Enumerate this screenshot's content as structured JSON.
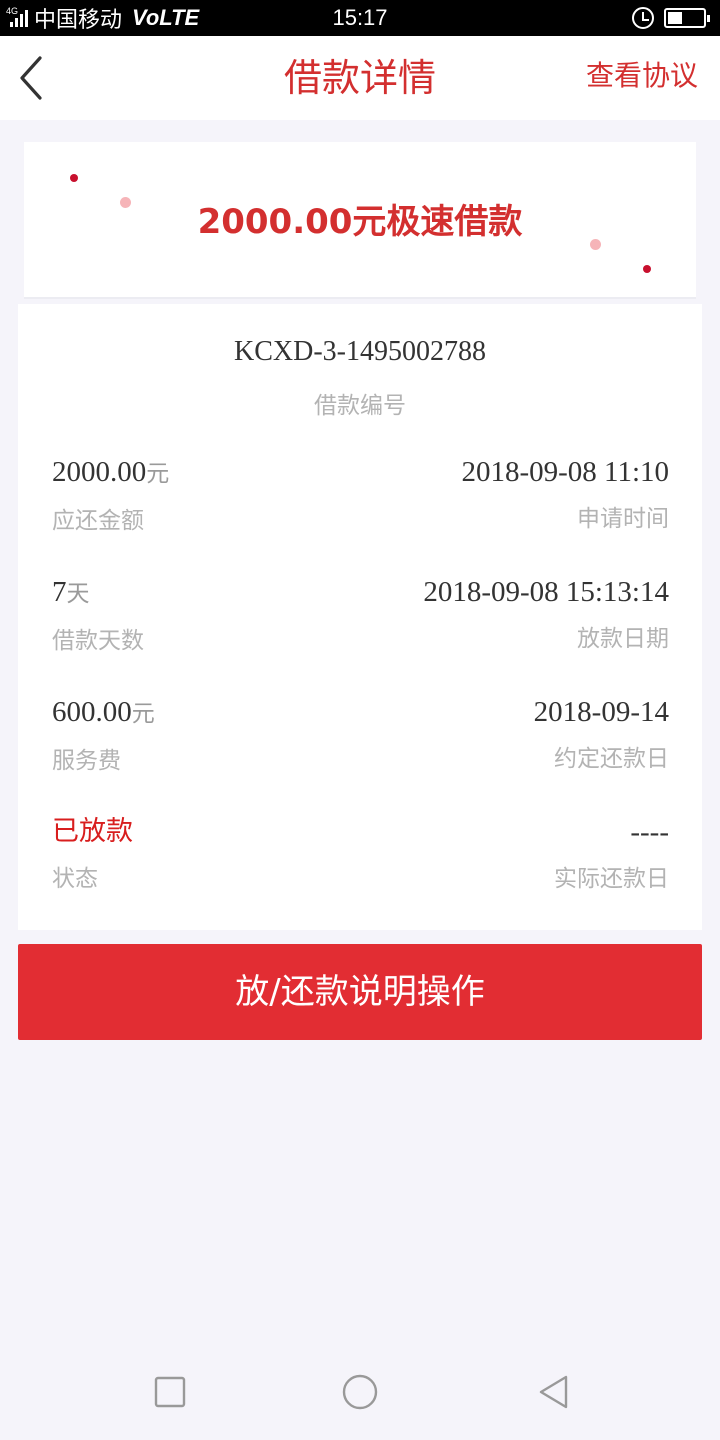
{
  "status_bar": {
    "network": "4G",
    "carrier": "中国移动",
    "volte": "VoLTE",
    "time": "15:17",
    "battery_level": 0.4
  },
  "nav": {
    "title": "借款详情",
    "action_label": "查看协议",
    "back_icon": "chevron-left-icon"
  },
  "banner": {
    "text": "2000.00元极速借款",
    "dot_colors": [
      "#c8102e",
      "#f6b4b8"
    ]
  },
  "loan": {
    "number": "KCXD-3-1495002788",
    "number_label": "借款编号",
    "rows": [
      {
        "left": {
          "value": "2000.00",
          "unit": "元",
          "label": "应还金额"
        },
        "right": {
          "value": "2018-09-08 11:10",
          "label": "申请时间"
        }
      },
      {
        "left": {
          "value": "7",
          "unit": "天",
          "label": "借款天数"
        },
        "right": {
          "value": "2018-09-08 15:13:14",
          "label": "放款日期"
        }
      },
      {
        "left": {
          "value": "600.00",
          "unit": "元",
          "label": "服务费"
        },
        "right": {
          "value": "2018-09-14",
          "label": "约定还款日"
        }
      },
      {
        "left": {
          "value": "已放款",
          "label": "状态"
        },
        "right": {
          "value": "----",
          "label": "实际还款日"
        }
      }
    ]
  },
  "action_button": {
    "label": "放/还款说明操作"
  },
  "colors": {
    "accent": "#d32f2f",
    "button": "#e22d33",
    "status": "#d81e1e",
    "background": "#f5f4fa"
  },
  "system_nav": {
    "icons": [
      "square-recents-icon",
      "circle-home-icon",
      "triangle-back-icon"
    ]
  }
}
